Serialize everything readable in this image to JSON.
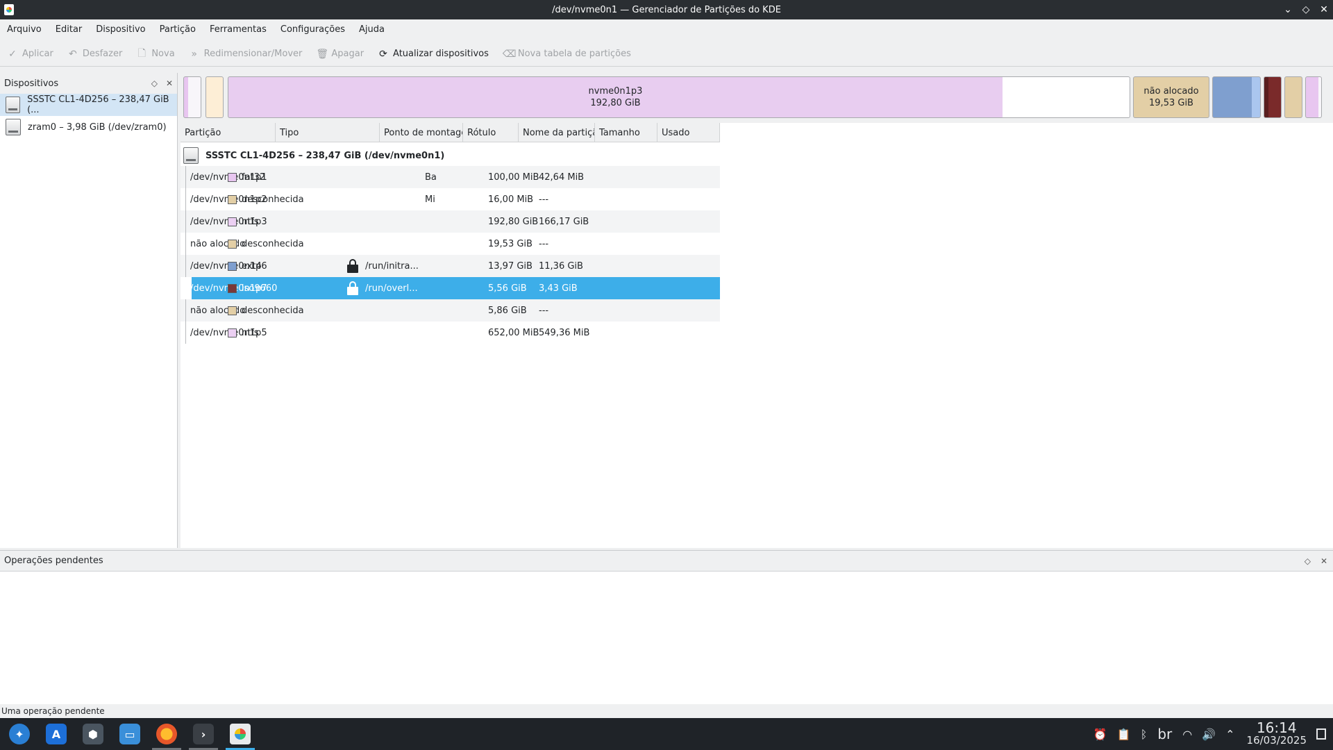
{
  "window": {
    "title": "/dev/nvme0n1 — Gerenciador de Partições do KDE",
    "controls": [
      "⌄",
      "◇",
      "✕"
    ]
  },
  "menu": [
    "Arquivo",
    "Editar",
    "Dispositivo",
    "Partição",
    "Ferramentas",
    "Configurações",
    "Ajuda"
  ],
  "toolbar": {
    "apply": "Aplicar",
    "undo": "Desfazer",
    "new": "Nova",
    "resize": "Redimensionar/Mover",
    "delete": "Apagar",
    "refresh": "Atualizar dispositivos",
    "new_table": "Nova tabela de partições"
  },
  "devices": {
    "title": "Dispositivos",
    "items": [
      {
        "label": "SSSTC CL1-4D256 – 238,47 GiB (..."
      },
      {
        "label": "zram0 – 3,98 GiB (/dev/zram0)"
      }
    ]
  },
  "partition_bar": {
    "main_name": "nvme0n1p3",
    "main_size": "192,80 GiB",
    "unalloc_name": "não alocado",
    "unalloc_size": "19,53 GiB"
  },
  "table": {
    "columns": [
      "Partição",
      "Tipo",
      "Ponto de montager",
      "Rótulo",
      "Nome da partiçãc",
      "Tamanho",
      "Usado"
    ],
    "device_label": "SSSTC CL1-4D256 – 238,47 GiB (/dev/nvme0n1)",
    "rows": [
      {
        "partition": "/dev/nvme0n1p1",
        "type": "fat32",
        "color": "#e8c6f0",
        "mount": "",
        "locked": false,
        "label": "",
        "name": "Ba",
        "size": "100,00 MiB",
        "used": "42,64 MiB"
      },
      {
        "partition": "/dev/nvme0n1p2",
        "type": "desconhecida",
        "color": "#e3cfa6",
        "mount": "",
        "locked": false,
        "label": "",
        "name": "Mi",
        "size": "16,00 MiB",
        "used": "---"
      },
      {
        "partition": "/dev/nvme0n1p3",
        "type": "ntfs",
        "color": "#ecd0f3",
        "mount": "",
        "locked": false,
        "label": "",
        "name": "",
        "size": "192,80 GiB",
        "used": "166,17 GiB"
      },
      {
        "partition": "não alocado",
        "type": "desconhecida",
        "color": "#e3cfa6",
        "mount": "",
        "locked": false,
        "label": "",
        "name": "",
        "size": "19,53 GiB",
        "used": "---"
      },
      {
        "partition": "/dev/nvme0n1p6",
        "type": "ext4",
        "color": "#7f9fcf",
        "mount": "/run/initra...",
        "locked": true,
        "label": "",
        "name": "",
        "size": "13,97 GiB",
        "used": "11,36 GiB"
      },
      {
        "partition": "/dev/nvme0n1p7",
        "type": "iso9660",
        "color": "#7a3838",
        "mount": "/run/overl...",
        "locked": true,
        "label": "",
        "name": "",
        "size": "5,56 GiB",
        "used": "3,43 GiB"
      },
      {
        "partition": "não alocado",
        "type": "desconhecida",
        "color": "#e3cfa6",
        "mount": "",
        "locked": false,
        "label": "",
        "name": "",
        "size": "5,86 GiB",
        "used": "---"
      },
      {
        "partition": "/dev/nvme0n1p5",
        "type": "ntfs",
        "color": "#ecd0f3",
        "mount": "",
        "locked": false,
        "label": "",
        "name": "",
        "size": "652,00 MiB",
        "used": "549,36 MiB"
      }
    ],
    "selected_row": 5
  },
  "pending": {
    "title": "Operações pendentes"
  },
  "status": "Uma operação pendente",
  "tray": {
    "keyboard": "br",
    "time": "16:14",
    "date": "16/03/2025"
  },
  "colors": {
    "accent": "#3daee9",
    "fat32": "#e8c6f0",
    "ntfs": "#ecd0f3",
    "unknown": "#e3cfa6",
    "ext4": "#7f9fcf",
    "iso9660": "#7a3838"
  }
}
